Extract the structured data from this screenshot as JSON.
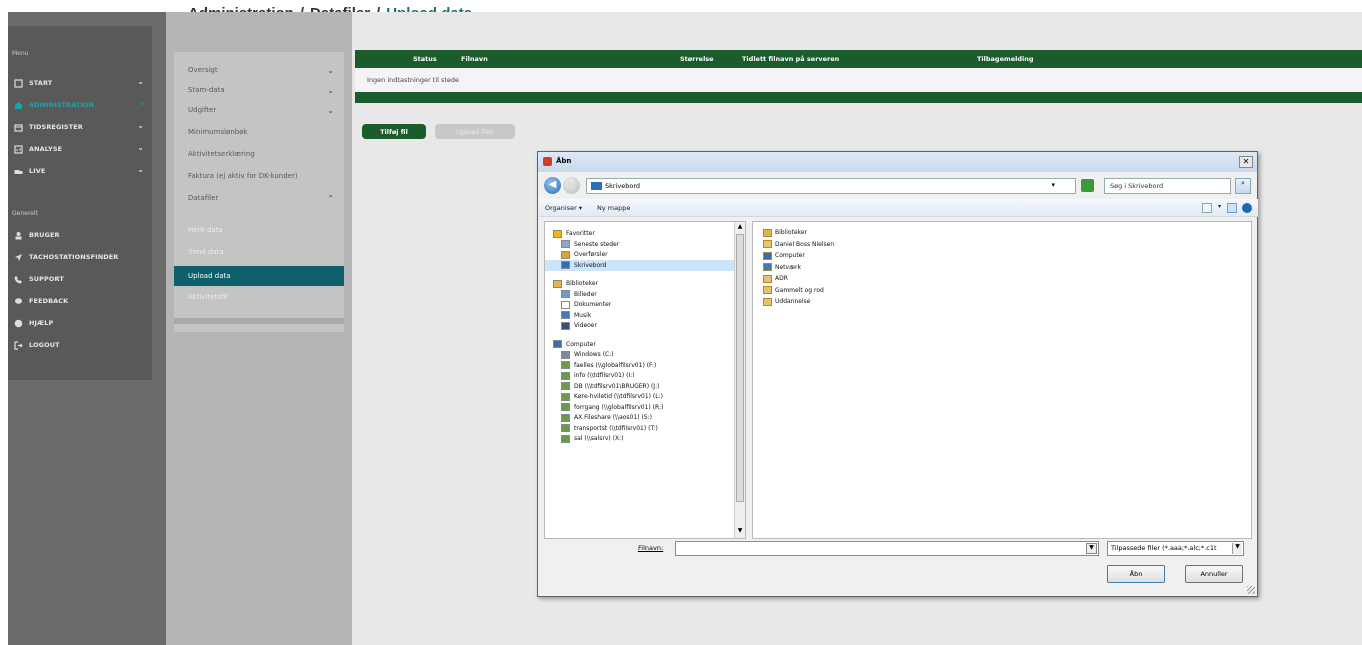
{
  "breadcrumb": {
    "root": "Administration",
    "parent": "Datafiler",
    "current": "Upload data",
    "separator": "/"
  },
  "sidebar": {
    "section_menu": "Menu",
    "section_generelt": "Generelt",
    "items": [
      {
        "label": "START",
        "icon": "dashboard-icon"
      },
      {
        "label": "ADMINISTRATION",
        "icon": "admin-icon"
      },
      {
        "label": "TIDSREGISTER",
        "icon": "calendar-icon"
      },
      {
        "label": "ANALYSE",
        "icon": "chart-icon"
      },
      {
        "label": "LIVE",
        "icon": "truck-icon"
      }
    ],
    "general_items": [
      {
        "label": "BRUGER",
        "icon": "user-icon"
      },
      {
        "label": "TACHOSTATIONSFINDER",
        "icon": "location-arrow-icon"
      },
      {
        "label": "SUPPORT",
        "icon": "phone-icon"
      },
      {
        "label": "FEEDBACK",
        "icon": "comment-icon"
      },
      {
        "label": "HJÆLP",
        "icon": "help-icon"
      },
      {
        "label": "LOGOUT",
        "icon": "logout-icon"
      }
    ]
  },
  "submenu": {
    "items": [
      {
        "label": "Oversigt",
        "chevron": "⌄"
      },
      {
        "label": "Stam-data",
        "chevron": "⌄"
      },
      {
        "label": "Udgifter",
        "chevron": "⌄"
      },
      {
        "label": "Minimumslønbøk",
        "chevron": ""
      },
      {
        "label": "Aktivitetserklæring",
        "chevron": ""
      },
      {
        "label": "Faktura (ej aktiv for DK-kunder)",
        "chevron": ""
      },
      {
        "label": "Datafiler",
        "chevron": "⌃"
      }
    ],
    "datafiler_children": [
      "Hent data",
      "Send data",
      "Upload data",
      "Aktivitetsfil"
    ]
  },
  "table": {
    "headers": [
      "Status",
      "Filnavn",
      "Størrelse",
      "Tidlett filnavn på serveren",
      "Tilbagemelding"
    ],
    "empty_text": "Ingen indtastninger til stede"
  },
  "actions": {
    "add_file": "Tilføj fil",
    "upload_files": "Upload filer"
  },
  "dialog": {
    "title": "Åbn",
    "address": "Skrivebord",
    "search_placeholder": "Søg i Skrivebord",
    "toolbar": {
      "organize": "Organiser ▾",
      "new_folder": "Ny mappe"
    },
    "nav_tree": [
      {
        "label": "Favoritter",
        "icon": "star-icon",
        "indent": 0,
        "selected": false
      },
      {
        "label": "Seneste steder",
        "icon": "recent-places-icon",
        "indent": 1,
        "selected": false
      },
      {
        "label": "Overførsler",
        "icon": "downloads-icon",
        "indent": 1,
        "selected": false
      },
      {
        "label": "Skrivebord",
        "icon": "desktop-icon",
        "indent": 1,
        "selected": true
      },
      {
        "label": "",
        "icon": "",
        "indent": 0,
        "selected": false
      },
      {
        "label": "Biblioteker",
        "icon": "libraries-icon",
        "indent": 0,
        "selected": false
      },
      {
        "label": "Billeder",
        "icon": "pictures-icon",
        "indent": 1,
        "selected": false
      },
      {
        "label": "Dokumenter",
        "icon": "documents-icon",
        "indent": 1,
        "selected": false
      },
      {
        "label": "Musik",
        "icon": "music-icon",
        "indent": 1,
        "selected": false
      },
      {
        "label": "Videoer",
        "icon": "videos-icon",
        "indent": 1,
        "selected": false
      },
      {
        "label": "",
        "icon": "",
        "indent": 0,
        "selected": false
      },
      {
        "label": "Computer",
        "icon": "computer-icon",
        "indent": 0,
        "selected": false
      },
      {
        "label": "Windows (C:)",
        "icon": "drive-icon",
        "indent": 1,
        "selected": false
      },
      {
        "label": "faelles (\\\\globalfilsrv01) (F:)",
        "icon": "network-drive-icon",
        "indent": 1,
        "selected": false
      },
      {
        "label": "info (\\\\tdfilsrv01) (I:)",
        "icon": "network-drive-icon",
        "indent": 1,
        "selected": false
      },
      {
        "label": "DB (\\\\tdfilsrv01\\BRUGER) (J:)",
        "icon": "network-drive-icon",
        "indent": 1,
        "selected": false
      },
      {
        "label": "Køre-hviletid (\\\\tdfilsrv01) (L:)",
        "icon": "network-drive-icon",
        "indent": 1,
        "selected": false
      },
      {
        "label": "forrgang (\\\\globalfilsrv01) (R:)",
        "icon": "network-drive-icon",
        "indent": 1,
        "selected": false
      },
      {
        "label": "AX Fileshare (\\\\aos01) (S:)",
        "icon": "network-drive-icon",
        "indent": 1,
        "selected": false
      },
      {
        "label": "transportst (\\\\tdfilsrv01) (T:)",
        "icon": "network-drive-icon",
        "indent": 1,
        "selected": false
      },
      {
        "label": "sal (\\\\salsrv) (X:)",
        "icon": "network-drive-icon",
        "indent": 1,
        "selected": false
      }
    ],
    "files": [
      {
        "label": "Biblioteker",
        "icon": "libraries-icon"
      },
      {
        "label": "Daniel Boss Nielsen",
        "icon": "user-folder-icon"
      },
      {
        "label": "Computer",
        "icon": "computer-icon"
      },
      {
        "label": "Netværk",
        "icon": "network-icon"
      },
      {
        "label": "ADR",
        "icon": "folder-icon"
      },
      {
        "label": "Gammelt og rod",
        "icon": "folder-icon"
      },
      {
        "label": "Uddannelse",
        "icon": "folder-icon"
      }
    ],
    "filename_label": "Filnavn:",
    "filename_value": "",
    "filter": "Tilpassede filer (*.aaa;*.alc;*.c1t",
    "open_button": "Åbn",
    "cancel_button": "Annuller"
  },
  "colors": {
    "primary_green": "#1a5c2b",
    "teal_active": "#0c5f6b",
    "sidebar_dark": "#595959"
  }
}
